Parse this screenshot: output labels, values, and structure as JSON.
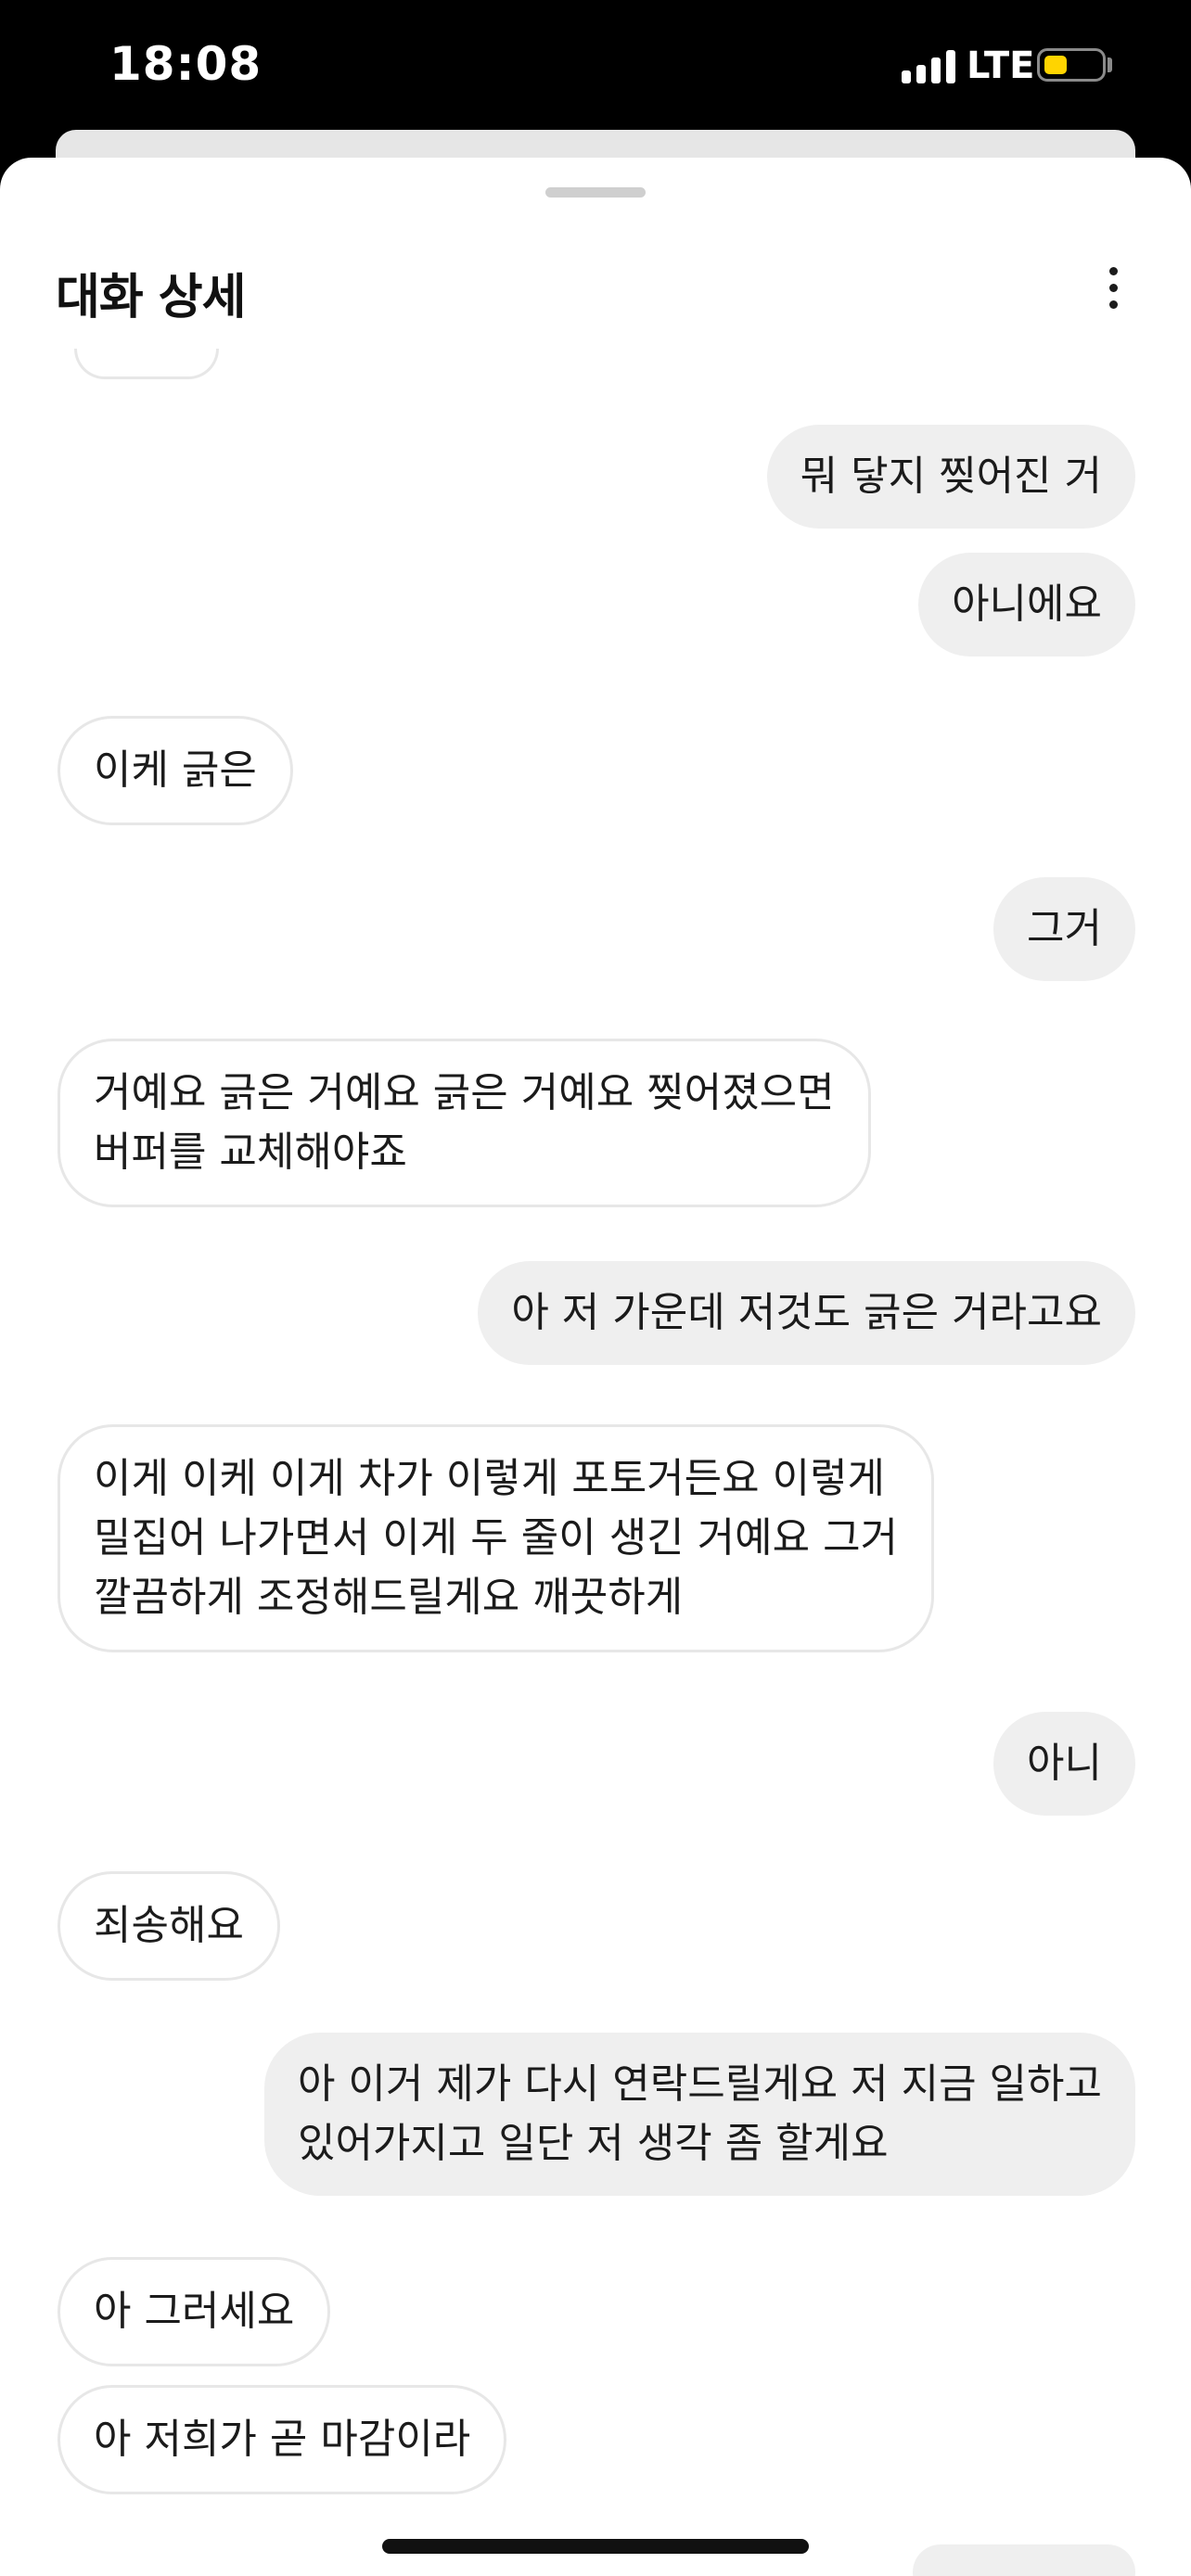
{
  "status_bar": {
    "time": "18:08",
    "network": "LTE"
  },
  "header": {
    "title": "대화 상세"
  },
  "messages": [
    {
      "side": "sent",
      "lines": [
        "뭐 닿지 찢어진 거"
      ]
    },
    {
      "side": "sent",
      "lines": [
        "아니에요"
      ]
    },
    {
      "side": "recv",
      "lines": [
        "이케 긁은"
      ]
    },
    {
      "side": "sent",
      "lines": [
        "그거"
      ]
    },
    {
      "side": "recv",
      "lines": [
        "거예요 긁은 거예요 긁은 거예요 찢어졌으면",
        "버퍼를 교체해야죠"
      ]
    },
    {
      "side": "sent",
      "lines": [
        "아 저 가운데 저것도 긁은 거라고요"
      ]
    },
    {
      "side": "recv",
      "lines": [
        "이게 이케 이게 차가 이렇게 포토거든요 이렇게",
        "밀집어 나가면서 이게 두 줄이 생긴 거예요 그거",
        "깔끔하게 조정해드릴게요 깨끗하게"
      ]
    },
    {
      "side": "sent",
      "lines": [
        "아니"
      ]
    },
    {
      "side": "recv",
      "lines": [
        "죄송해요"
      ]
    },
    {
      "side": "sent",
      "lines": [
        "아 이거 제가 다시 연락드릴게요 저 지금 일하고",
        "있어가지고 일단 저 생각 좀 할게요"
      ]
    },
    {
      "side": "recv",
      "lines": [
        "아 그러세요"
      ]
    },
    {
      "side": "recv",
      "lines": [
        "아 저희가 곧 마감이라"
      ]
    }
  ]
}
